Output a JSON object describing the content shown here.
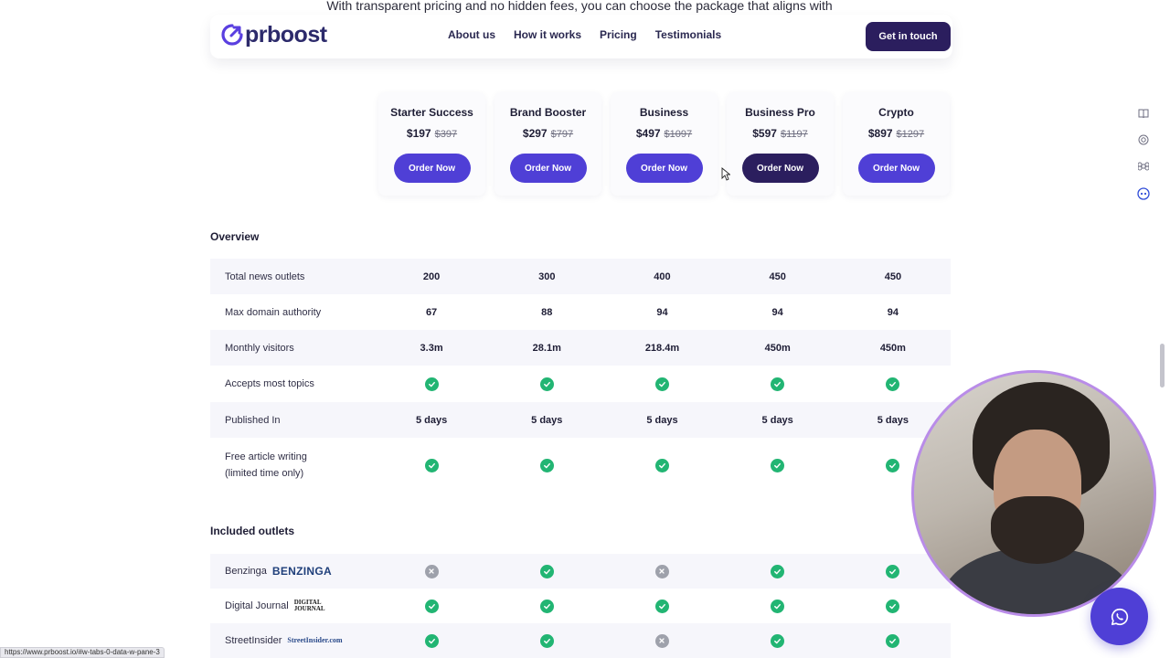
{
  "intro": "With transparent pricing and no hidden fees, you can choose the package that aligns with",
  "nav": {
    "logo_text": "prboost",
    "links": [
      "About us",
      "How it works",
      "Pricing",
      "Testimonials"
    ],
    "cta": "Get in touch"
  },
  "plans": [
    {
      "name": "Starter Success",
      "price": "$197",
      "old_price": "$397",
      "button": "Order Now"
    },
    {
      "name": "Brand Booster",
      "price": "$297",
      "old_price": "$797",
      "button": "Order Now"
    },
    {
      "name": "Business",
      "price": "$497",
      "old_price": "$1097",
      "button": "Order Now"
    },
    {
      "name": "Business Pro",
      "price": "$597",
      "old_price": "$1197",
      "button": "Order Now"
    },
    {
      "name": "Crypto",
      "price": "$897",
      "old_price": "$1297",
      "button": "Order Now"
    }
  ],
  "overview": {
    "title": "Overview",
    "rows": [
      {
        "label": "Total news outlets",
        "values": [
          "200",
          "300",
          "400",
          "450",
          "450"
        ]
      },
      {
        "label": "Max domain authority",
        "values": [
          "67",
          "88",
          "94",
          "94",
          "94"
        ]
      },
      {
        "label": "Monthly visitors",
        "values": [
          "3.3m",
          "28.1m",
          "218.4m",
          "450m",
          "450m"
        ]
      },
      {
        "label": "Accepts most topics",
        "values": [
          "check",
          "check",
          "check",
          "check",
          "check"
        ]
      },
      {
        "label": "Published In",
        "values": [
          "5 days",
          "5 days",
          "5 days",
          "5 days",
          "5 days"
        ]
      },
      {
        "label_line1": "Free article writing",
        "label_line2": "(limited time only)",
        "values": [
          "check",
          "check",
          "check",
          "check",
          "check"
        ]
      }
    ]
  },
  "outlets": {
    "title": "Included outlets",
    "rows": [
      {
        "label": "Benzinga",
        "logo": "BENZINGA",
        "values": [
          "cross",
          "check",
          "cross",
          "check",
          "check"
        ]
      },
      {
        "label": "Digital Journal",
        "logo": "DIGITAL JOURNAL",
        "values": [
          "check",
          "check",
          "check",
          "check",
          "check"
        ]
      },
      {
        "label": "StreetInsider",
        "logo": "StreetInsider.com",
        "values": [
          "check",
          "check",
          "cross",
          "check",
          "check"
        ]
      }
    ]
  },
  "status_url": "https://www.prboost.io/#w-tabs-0-data-w-pane-3",
  "colors": {
    "primary": "#4f3fd6",
    "dark": "#2b1e5e",
    "check": "#22b573",
    "cross": "#9ea1ab"
  }
}
